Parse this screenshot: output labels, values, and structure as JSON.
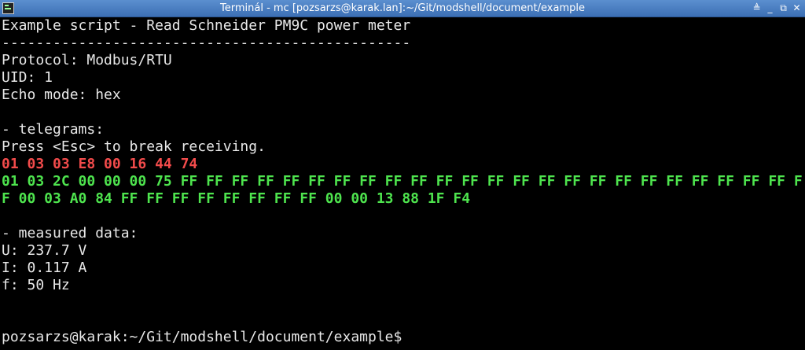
{
  "window": {
    "title": "Terminál - mc [pozsarzs@karak.lan]:~/Git/modshell/document/example",
    "buttons": [
      "shade-icon",
      "minimize-icon",
      "maximize-icon",
      "close-icon"
    ],
    "glyphs": {
      "shade": "≜",
      "minimize": "_",
      "maximize": "⧉",
      "close": "✕"
    }
  },
  "colors": {
    "background": "#000000",
    "text": "#e8e8e8",
    "sent_telegram": "#f24b4b",
    "received_telegram": "#4ee44e",
    "titlebar": "#4a7fc2"
  },
  "terminal": {
    "header": "Example script - Read Schneider PM9C power meter",
    "separator": "------------------------------------------------",
    "protocol": "Protocol: Modbus/RTU",
    "uid": "UID: 1",
    "echo_mode": "Echo mode: hex",
    "telegrams_heading": "- telegrams:",
    "break_hint": "Press <Esc> to break receiving.",
    "sent_telegram": "01 03 03 E8 00 16 44 74",
    "received_telegram_line1": "01 03 2C 00 00 00 75 FF FF FF FF FF FF FF FF FF FF FF FF FF FF FF FF FF FF FF FF FF FF FF FF F",
    "received_telegram_line2": "F 00 03 A0 84 FF FF FF FF FF FF FF FF 00 00 13 88 1F F4",
    "measured_heading": "- measured data:",
    "voltage": "U: 237.7 V",
    "current": "I: 0.117 A",
    "frequency": "f: 50 Hz",
    "prompt": "pozsarzs@karak:~/Git/modshell/document/example$"
  }
}
